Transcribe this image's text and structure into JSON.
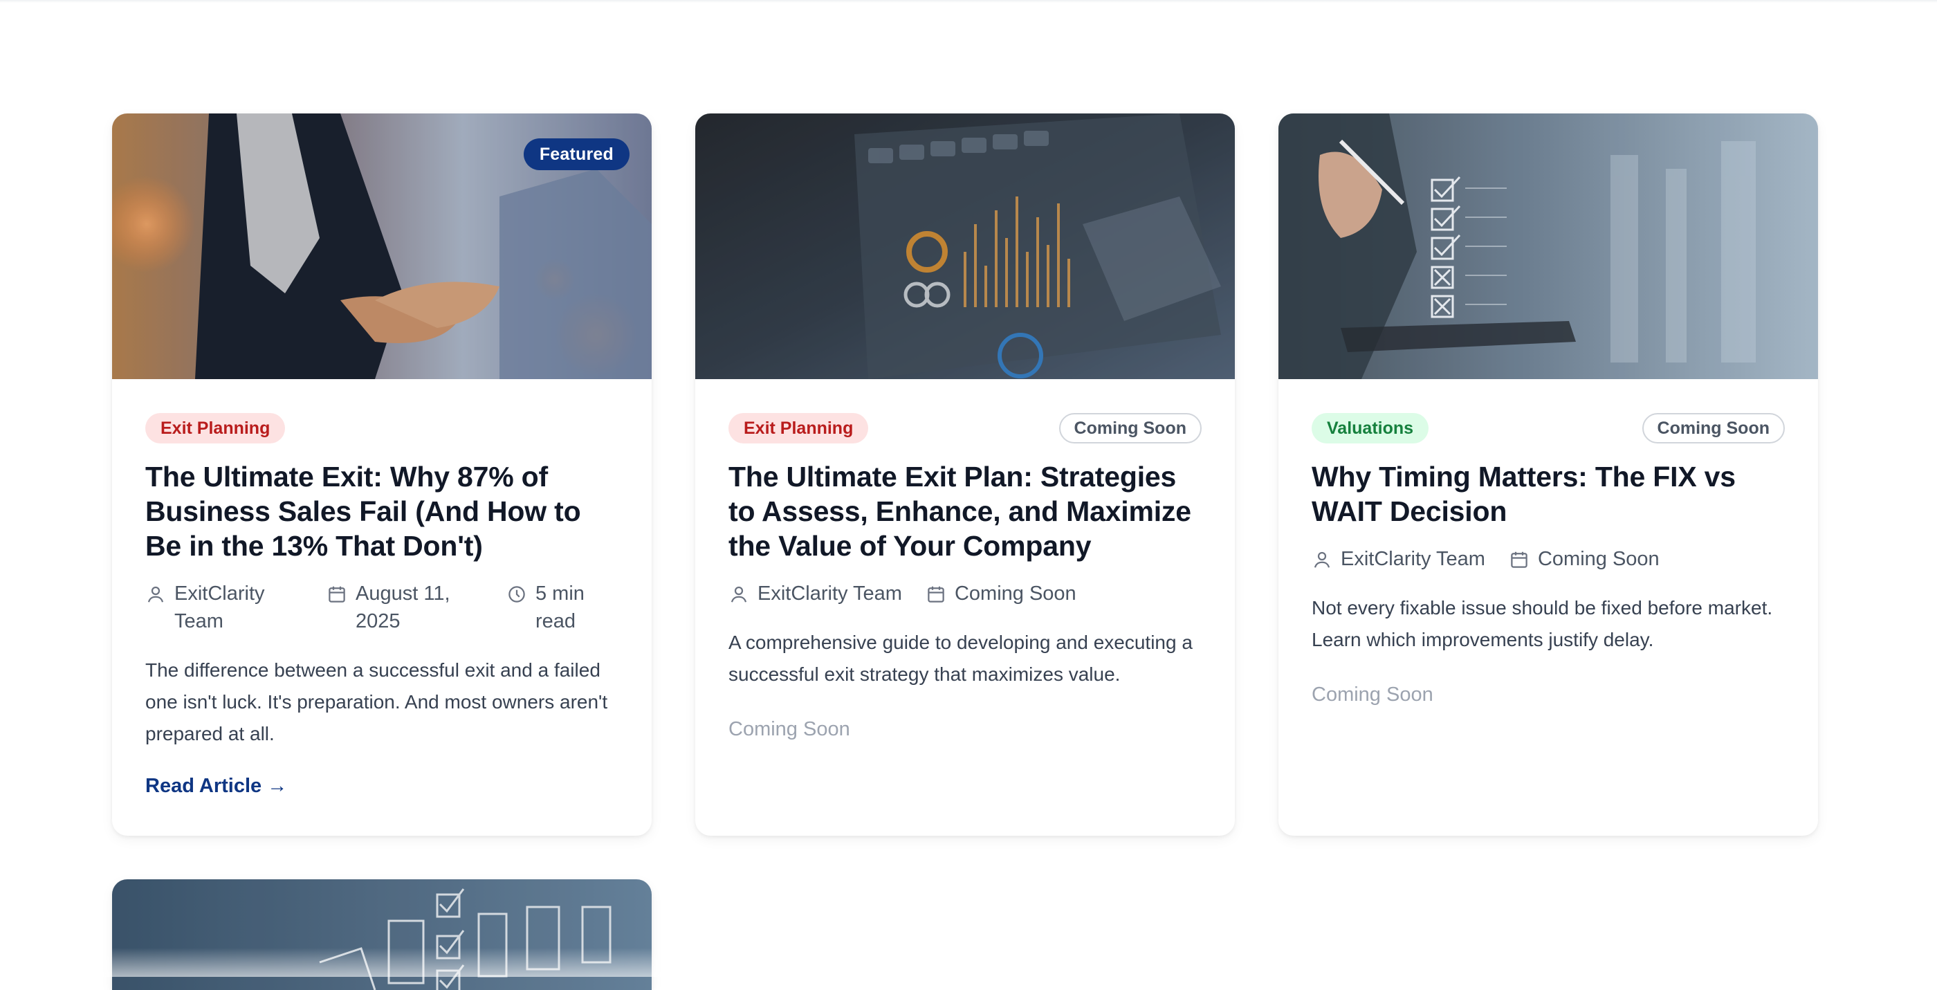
{
  "articles": [
    {
      "badge": "Featured",
      "category": "Exit Planning",
      "status": "",
      "title": "The Ultimate Exit: Why 87% of Business Sales Fail (And How to Be in the 13% That Don't)",
      "author": "ExitClarity Team",
      "date": "August 11, 2025",
      "read_time": "5 min read",
      "excerpt": "The difference between a successful exit and a failed one isn't luck. It's preparation. And most owners aren't prepared at all.",
      "cta": "Read Article →"
    },
    {
      "category": "Exit Planning",
      "status": "Coming Soon",
      "title": "The Ultimate Exit Plan: Strategies to Assess, Enhance, and Maximize the Value of Your Company",
      "author": "ExitClarity Team",
      "date": "Coming Soon",
      "excerpt": "A comprehensive guide to developing and executing a successful exit strategy that maximizes value.",
      "cta": "Coming Soon"
    },
    {
      "category": "Valuations",
      "status": "Coming Soon",
      "title": "Why Timing Matters: The FIX vs WAIT Decision",
      "author": "ExitClarity Team",
      "date": "Coming Soon",
      "excerpt": "Not every fixable issue should be fixed before market. Learn which improvements justify delay.",
      "cta": "Coming Soon"
    }
  ],
  "icons": {
    "author": "user-icon",
    "date": "calendar-icon",
    "read_time": "clock-icon"
  },
  "colors": {
    "accent": "#0f3683",
    "tag_red_bg": "#fde2e2",
    "tag_red_text": "#b91c1c",
    "tag_green_bg": "#dcfce7",
    "tag_green_text": "#15803d",
    "muted": "#9ca3af"
  }
}
